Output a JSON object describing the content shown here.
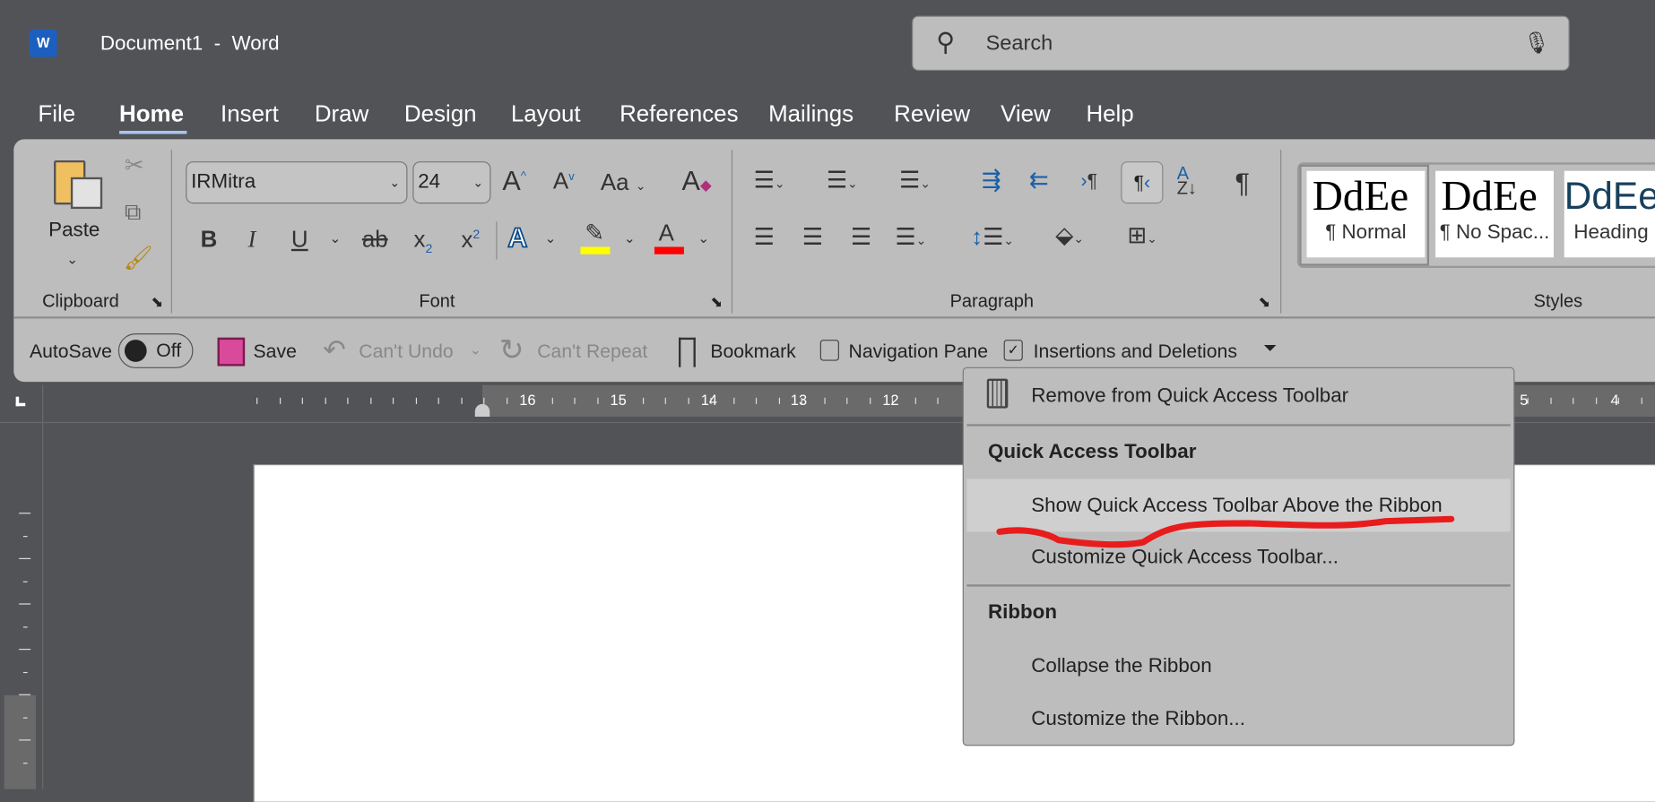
{
  "titlebar": {
    "app_icon": "word-icon",
    "title": "Document1  -  Word",
    "search_placeholder": "Search",
    "search_icon": "search-icon",
    "mic_icon": "microphone-icon"
  },
  "tabs": [
    {
      "label": "File"
    },
    {
      "label": "Home",
      "active": true
    },
    {
      "label": "Insert"
    },
    {
      "label": "Draw"
    },
    {
      "label": "Design"
    },
    {
      "label": "Layout"
    },
    {
      "label": "References"
    },
    {
      "label": "Mailings"
    },
    {
      "label": "Review"
    },
    {
      "label": "View"
    },
    {
      "label": "Help"
    }
  ],
  "ribbon": {
    "clipboard": {
      "label": "Clipboard",
      "paste": "Paste"
    },
    "font": {
      "label": "Font",
      "font_name": "IRMitra",
      "font_size": "24",
      "highlight_color": "#ffff00",
      "font_color": "#ff0000"
    },
    "paragraph": {
      "label": "Paragraph"
    },
    "styles": {
      "label": "Styles",
      "preview": "DdEe",
      "items": [
        {
          "name": "¶ Normal"
        },
        {
          "name": "¶ No Spac..."
        },
        {
          "name": "Heading"
        }
      ]
    }
  },
  "qat": {
    "autosave": "AutoSave",
    "toggle": "Off",
    "save": "Save",
    "undo": "Can't Undo",
    "repeat": "Can't Repeat",
    "bookmark": "Bookmark",
    "nav_pane": "Navigation Pane",
    "nav_pane_checked": false,
    "insdel": "Insertions and Deletions",
    "insdel_checked": true
  },
  "ruler": {
    "numbers": [
      "16",
      "15",
      "14",
      "13",
      "12",
      "5",
      "4"
    ]
  },
  "context_menu": {
    "remove": "Remove from Quick Access Toolbar",
    "qat_header": "Quick Access Toolbar",
    "show_above": "Show Quick Access Toolbar Above the Ribbon",
    "customize_qat": "Customize Quick Access Toolbar...",
    "ribbon_header": "Ribbon",
    "collapse": "Collapse the Ribbon",
    "customize_ribbon": "Customize the Ribbon..."
  },
  "annotation_color": "#e81c1c"
}
